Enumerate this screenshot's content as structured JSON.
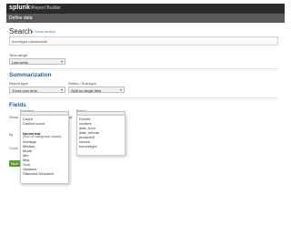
{
  "header": {
    "logo": "splunk",
    "logo_arrow": ">",
    "app_title": "Report Builder"
  },
  "subheader": {
    "title": "Define data"
  },
  "search": {
    "title": "Search",
    "edit_link": "▸ Show search",
    "value": "eventtype=downloads"
  },
  "time_range": {
    "label": "Time range",
    "selected": "Last week",
    "chevron": "▾"
  },
  "summarization": {
    "title": "Summarization",
    "report_type": {
      "label": "Report type",
      "selected": "Trend over time",
      "chevron": "▾"
    },
    "series": {
      "label": "Series / Sub-type",
      "selected": "Split by single field",
      "chevron": "▾"
    }
  },
  "fields": {
    "title": "Fields",
    "function_label": "Function",
    "field_label": "Field 1",
    "show_label": "Show",
    "of_label": "of",
    "by_label": "by",
    "small_link": "Scale",
    "button_label": "Next",
    "function_options": [
      "Count",
      "Distinct count",
      "",
      "Numerical",
      "(Sum of categorical values)",
      "Average",
      "Median",
      "Mode",
      "Min",
      "Max",
      "Sum",
      "Variance",
      "Standard Deviation"
    ],
    "field_options": [
      "Events",
      "cookies",
      "date_hour",
      "date_minute",
      "productID",
      "source",
      "sourcetype"
    ]
  }
}
